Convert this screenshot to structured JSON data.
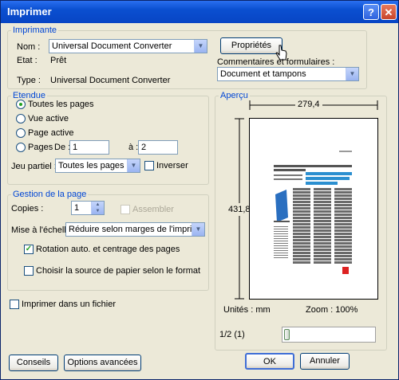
{
  "title": "Imprimer",
  "help_glyph": "?",
  "close_glyph": "✕",
  "printer": {
    "legend": "Imprimante",
    "name_label": "Nom :",
    "name_value": "Universal Document Converter",
    "state_label": "Etat :",
    "state_value": "Prêt",
    "type_label": "Type :",
    "type_value": "Universal Document Converter",
    "properties_button": "Propriétés",
    "comments_label": "Commentaires et formulaires :",
    "comments_value": "Document et tampons"
  },
  "range": {
    "legend": "Etendue",
    "all_pages": "Toutes les pages",
    "current_view": "Vue active",
    "current_page": "Page active",
    "pages": "Pages",
    "from_label": "De :",
    "from_value": "1",
    "to_label": "à :",
    "to_value": "2",
    "subset_label": "Jeu partiel :",
    "subset_value": "Toutes les pages",
    "reverse_label": "Inverser",
    "selected": "all_pages"
  },
  "handling": {
    "legend": "Gestion de la page",
    "copies_label": "Copies :",
    "copies_value": "1",
    "collate_label": "Assembler",
    "scaling_label": "Mise à l'échelle :",
    "scaling_value": "Réduire selon marges de l'imprimante",
    "autorotate_label": "Rotation auto. et centrage des pages",
    "autorotate_checked": true,
    "paper_source_label": "Choisir la source de papier selon le format",
    "paper_source_checked": false
  },
  "print_to_file_label": "Imprimer dans un fichier",
  "preview": {
    "legend": "Aperçu",
    "width_value": "279,4",
    "height_value": "431,8",
    "units": "Unités : mm",
    "zoom": "Zoom : 100%",
    "page_counter": "1/2 (1)",
    "page_slider_position": 0.0
  },
  "buttons": {
    "tips": "Conseils",
    "advanced": "Options avancées",
    "ok": "OK",
    "cancel": "Annuler"
  }
}
